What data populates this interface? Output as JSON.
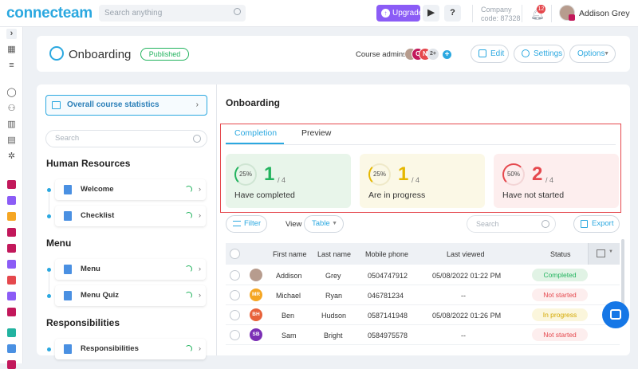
{
  "topbar": {
    "logo": "connecteam",
    "search_placeholder": "Search anything",
    "upgrade_label": "Upgrade",
    "play_label": "▶",
    "help_label": "?",
    "company_label": "Company",
    "company_code": "code: 87328",
    "notifications_count": "12",
    "user_name": "Addison Grey"
  },
  "header": {
    "title": "Onboarding",
    "status_badge": "Published",
    "admins_label": "Course admins",
    "admin_avatars": [
      "",
      "C",
      "N"
    ],
    "admin_more": "2+",
    "edit_label": "Edit",
    "settings_label": "Settings",
    "options_label": "Options"
  },
  "left": {
    "stats_label": "Overall course statistics",
    "search_placeholder": "Search",
    "sections": [
      {
        "title": "Human Resources",
        "items": [
          "Welcome",
          "Checklist"
        ]
      },
      {
        "title": "Menu",
        "items": [
          "Menu",
          "Menu Quiz"
        ]
      },
      {
        "title": "Responsibilities",
        "items": [
          "Responsibilities"
        ]
      }
    ]
  },
  "right": {
    "title": "Onboarding",
    "tabs": [
      "Completion",
      "Preview"
    ],
    "cards": [
      {
        "percent": "25%",
        "count": "1",
        "total": "/ 4",
        "label": "Have completed",
        "color": "#22b35e",
        "bg": "#e8f5ea"
      },
      {
        "percent": "25%",
        "count": "1",
        "total": "/ 4",
        "label": "Are in progress",
        "color": "#e5b700",
        "bg": "#fbf8e6"
      },
      {
        "percent": "50%",
        "count": "2",
        "total": "/ 4",
        "label": "Have not started",
        "color": "#e5484d",
        "bg": "#fdeeee"
      }
    ],
    "filter_label": "Filter",
    "view_label": "View",
    "view_value": "Table",
    "search_placeholder": "Search",
    "export_label": "Export"
  },
  "table": {
    "columns": [
      "First name",
      "Last name",
      "Mobile phone",
      "Last viewed",
      "Status"
    ],
    "rows": [
      {
        "initials": "",
        "avatar_color": "#b79c8e",
        "first": "Addison",
        "last": "Grey",
        "phone": "0504747912",
        "viewed": "05/08/2022 01:22 PM",
        "status": "Completed"
      },
      {
        "initials": "MR",
        "avatar_color": "#f5a623",
        "first": "Michael",
        "last": "Ryan",
        "phone": "046781234",
        "viewed": "--",
        "status": "Not started"
      },
      {
        "initials": "BH",
        "avatar_color": "#e8623a",
        "first": "Ben",
        "last": "Hudson",
        "phone": "0587141948",
        "viewed": "05/08/2022 01:26 PM",
        "status": "In progress"
      },
      {
        "initials": "SB",
        "avatar_color": "#7b2fb5",
        "first": "Sam",
        "last": "Bright",
        "phone": "0584975578",
        "viewed": "--",
        "status": "Not started"
      }
    ]
  },
  "colors": {
    "accent": "#2ba8e0",
    "upgrade": "#8b5cf6",
    "highlight_box": "#e5484d"
  }
}
